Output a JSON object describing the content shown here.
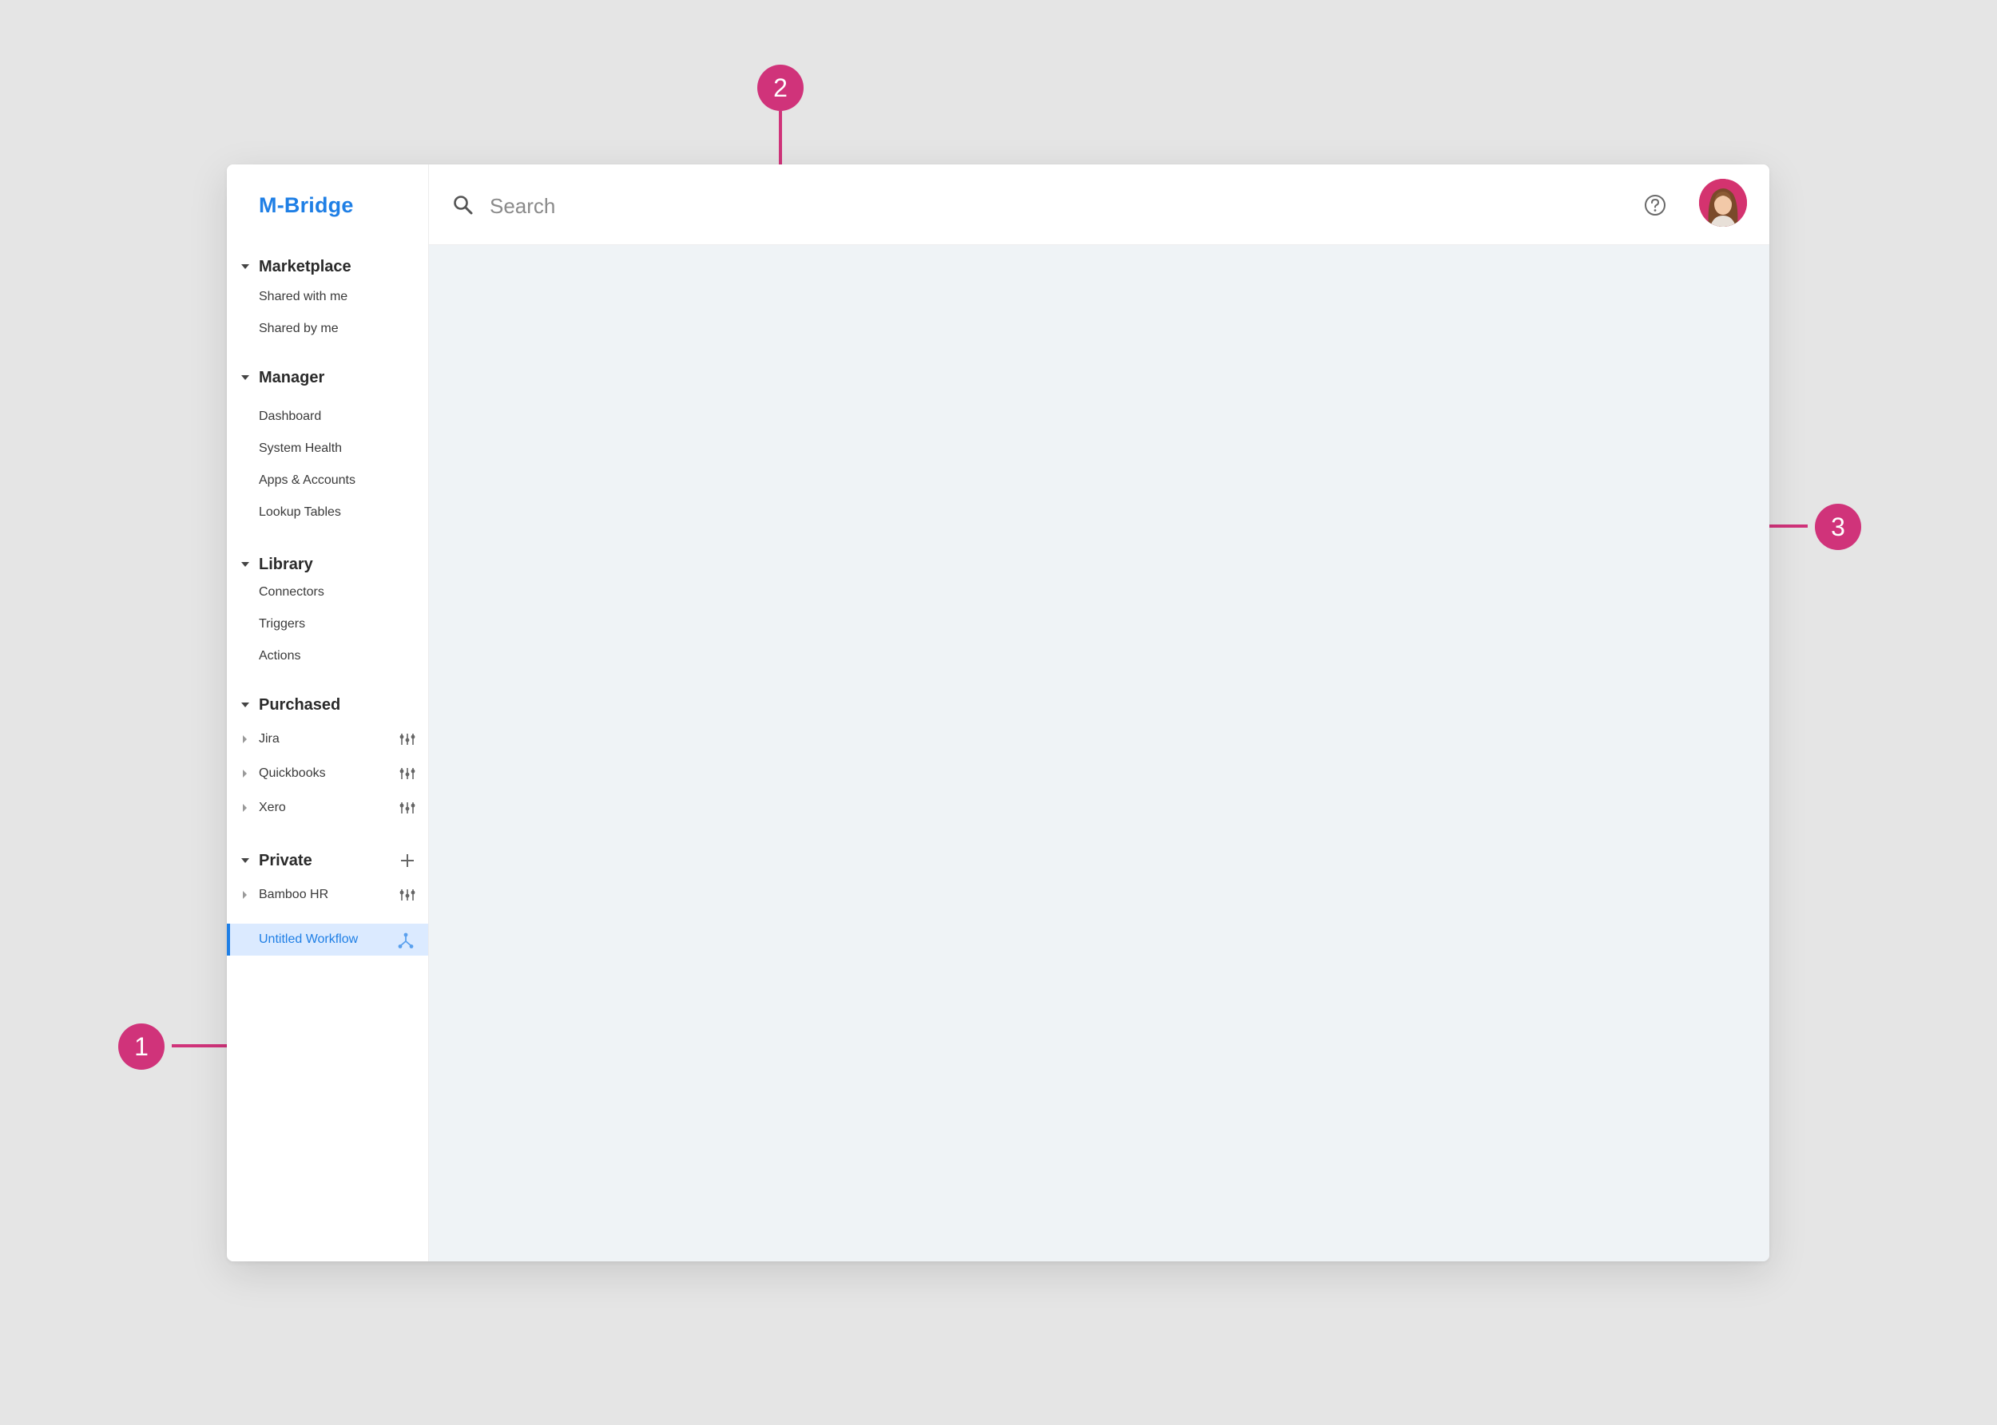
{
  "app": {
    "brand": "M-Bridge"
  },
  "search": {
    "placeholder": "Search"
  },
  "sidebar": {
    "sections": {
      "marketplace": {
        "title": "Marketplace",
        "items": [
          "Shared with me",
          "Shared by me"
        ]
      },
      "manager": {
        "title": "Manager",
        "items": [
          "Dashboard",
          "System Health",
          "Apps & Accounts",
          "Lookup Tables"
        ]
      },
      "library": {
        "title": "Library",
        "items": [
          "Connectors",
          "Triggers",
          "Actions"
        ]
      },
      "purchased": {
        "title": "Purchased",
        "items": [
          "Jira",
          "Quickbooks",
          "Xero"
        ]
      },
      "private": {
        "title": "Private",
        "items": [
          "Bamboo HR"
        ]
      }
    },
    "active_item": "Untitled Workflow"
  },
  "callouts": [
    "1",
    "2",
    "3"
  ],
  "colors": {
    "accent": "#1f7fe5",
    "callout": "#d0337a",
    "content_bg": "#eff3f6",
    "active_bg": "#dbeaff"
  }
}
